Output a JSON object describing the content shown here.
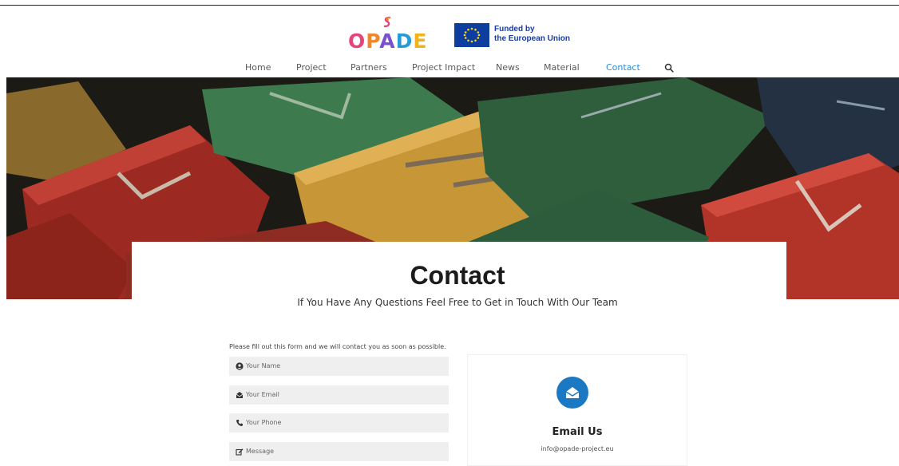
{
  "header": {
    "logo_text": "OPADE",
    "eu_line1": "Funded by",
    "eu_line2": "the European Union"
  },
  "nav": {
    "items": [
      {
        "label": "Home"
      },
      {
        "label": "Project"
      },
      {
        "label": "Partners"
      },
      {
        "label": "Project Impact"
      },
      {
        "label": "News"
      },
      {
        "label": "Material"
      },
      {
        "label": "Contact",
        "active": true
      }
    ],
    "search_icon": "search-icon"
  },
  "hero": {
    "image": "colorful wooden letter blocks",
    "title": "Contact",
    "subtitle": "If You Have Any Questions Feel Free to Get in Touch With Our Team"
  },
  "form": {
    "intro": "Please fill out this form and we will contact you as soon as possible.",
    "fields": [
      {
        "placeholder": "Your Name",
        "icon": "user-icon"
      },
      {
        "placeholder": "Your Email",
        "icon": "envelope-icon"
      },
      {
        "placeholder": "Your Phone",
        "icon": "phone-icon"
      },
      {
        "placeholder": "Message",
        "icon": "edit-icon"
      }
    ]
  },
  "email_card": {
    "icon": "open-envelope-icon",
    "heading": "Email Us",
    "address": "info@opade-project.eu"
  },
  "colors": {
    "accent": "#2b8bd3",
    "email_circle": "#1a79c2",
    "eu_blue": "#0d3d9e",
    "field_bg": "#efefef"
  }
}
